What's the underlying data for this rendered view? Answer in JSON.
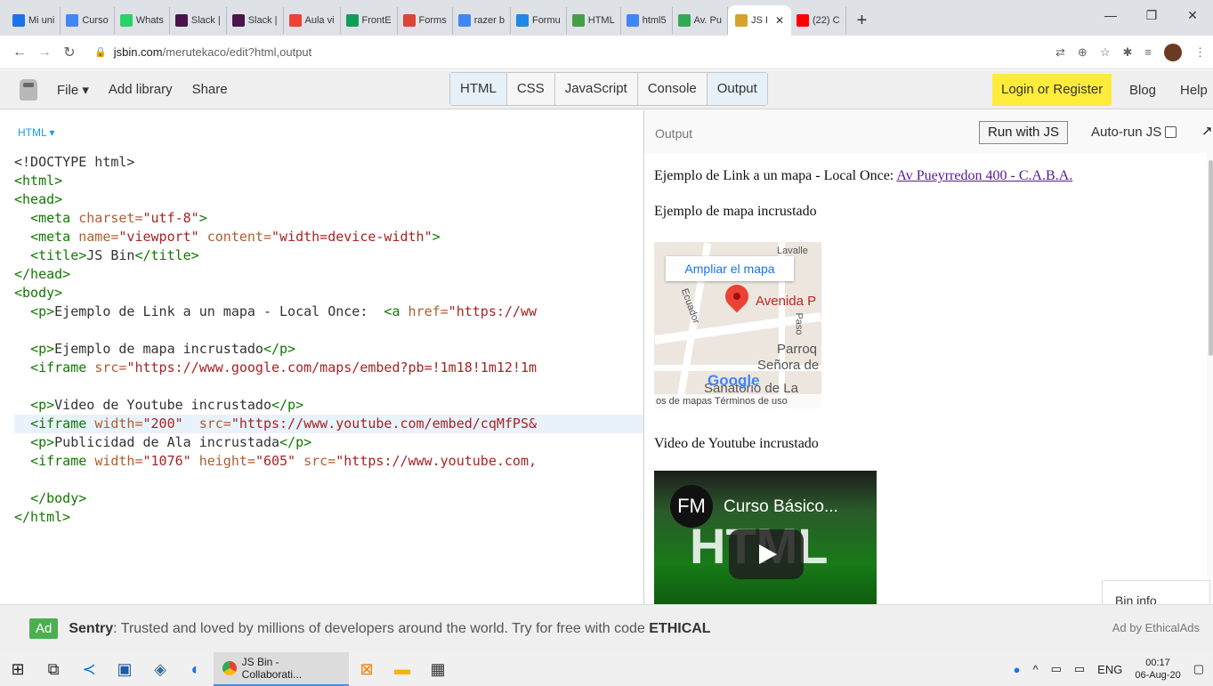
{
  "browser": {
    "tabs": [
      {
        "label": "Mi uni",
        "color": "#1a73e8"
      },
      {
        "label": "Curso",
        "color": "#4285f4"
      },
      {
        "label": "Whats",
        "color": "#25d366"
      },
      {
        "label": "Slack |",
        "color": "#4a154b"
      },
      {
        "label": "Slack |",
        "color": "#4a154b"
      },
      {
        "label": "Aula vi",
        "color": "#ea4335"
      },
      {
        "label": "FrontE",
        "color": "#0f9d58"
      },
      {
        "label": "Forms",
        "color": "#db4437"
      },
      {
        "label": "razer b",
        "color": "#4285f4"
      },
      {
        "label": "Formu",
        "color": "#1e88e5"
      },
      {
        "label": "HTML",
        "color": "#43a047"
      },
      {
        "label": "html5",
        "color": "#4285f4"
      },
      {
        "label": "Av. Pu",
        "color": "#34a853"
      },
      {
        "label": "JS I",
        "color": "#d6a32a"
      },
      {
        "label": "(22) C",
        "color": "#ff0000"
      }
    ],
    "new_tab": "+",
    "window_controls": [
      "—",
      "❐",
      "✕"
    ],
    "url_host": "jsbin.com",
    "url_path": "/merutekaco/edit?html,output"
  },
  "jsbin": {
    "menu": {
      "file": "File ▾",
      "add_library": "Add library",
      "share": "Share"
    },
    "panels": [
      "HTML",
      "CSS",
      "JavaScript",
      "Console",
      "Output"
    ],
    "login": "Login or Register",
    "blog": "Blog",
    "help": "Help"
  },
  "editor": {
    "label": "HTML ▾",
    "lines": [
      [
        [
          "tx",
          "<!DOCTYPE html>"
        ]
      ],
      [
        [
          "tg",
          "<html>"
        ]
      ],
      [
        [
          "tg",
          "<head>"
        ]
      ],
      [
        [
          "tx",
          "  "
        ],
        [
          "tg",
          "<meta "
        ],
        [
          "at",
          "charset="
        ],
        [
          "st",
          "\"utf-8\""
        ],
        [
          "tg",
          ">"
        ]
      ],
      [
        [
          "tx",
          "  "
        ],
        [
          "tg",
          "<meta "
        ],
        [
          "at",
          "name="
        ],
        [
          "st",
          "\"viewport\" "
        ],
        [
          "at",
          "content="
        ],
        [
          "st",
          "\"width=device-width\""
        ],
        [
          "tg",
          ">"
        ]
      ],
      [
        [
          "tx",
          "  "
        ],
        [
          "tg",
          "<title>"
        ],
        [
          "tx",
          "JS Bin"
        ],
        [
          "tg",
          "</title>"
        ]
      ],
      [
        [
          "tg",
          "</head>"
        ]
      ],
      [
        [
          "tg",
          "<body>"
        ]
      ],
      [
        [
          "tx",
          "  "
        ],
        [
          "tg",
          "<p>"
        ],
        [
          "tx",
          "Ejemplo de Link a un mapa - Local Once:  "
        ],
        [
          "tg",
          "<a "
        ],
        [
          "at",
          "href="
        ],
        [
          "st",
          "\"https://ww"
        ]
      ],
      [
        [
          "tx",
          ""
        ]
      ],
      [
        [
          "tx",
          "  "
        ],
        [
          "tg",
          "<p>"
        ],
        [
          "tx",
          "Ejemplo de mapa incrustado"
        ],
        [
          "tg",
          "</p>"
        ]
      ],
      [
        [
          "tx",
          "  "
        ],
        [
          "tg",
          "<iframe "
        ],
        [
          "at",
          "src="
        ],
        [
          "st",
          "\"https://www.google.com/maps/embed?pb=!1m18!1m12!1m"
        ]
      ],
      [
        [
          "tx",
          ""
        ]
      ],
      [
        [
          "tx",
          "  "
        ],
        [
          "tg",
          "<p>"
        ],
        [
          "tx",
          "Video de Youtube incrustado"
        ],
        [
          "tg",
          "</p>"
        ]
      ],
      [
        [
          "tx",
          "  "
        ],
        [
          "tg",
          "<iframe "
        ],
        [
          "at",
          "width="
        ],
        [
          "st",
          "\"200\"  "
        ],
        [
          "at",
          "src="
        ],
        [
          "st",
          "\"https://www.youtube.com/embed/cqMfPS&"
        ]
      ],
      [
        [
          "tx",
          "  "
        ],
        [
          "tg",
          "<p>"
        ],
        [
          "tx",
          "Publicidad de Ala incrustada"
        ],
        [
          "tg",
          "</p>"
        ]
      ],
      [
        [
          "tx",
          "  "
        ],
        [
          "tg",
          "<iframe "
        ],
        [
          "at",
          "width="
        ],
        [
          "st",
          "\"1076\" "
        ],
        [
          "at",
          "height="
        ],
        [
          "st",
          "\"605\" "
        ],
        [
          "at",
          "src="
        ],
        [
          "st",
          "\"https://www.youtube.com,"
        ]
      ],
      [
        [
          "tx",
          ""
        ]
      ],
      [
        [
          "tx",
          "  "
        ],
        [
          "tg",
          "</body>"
        ]
      ],
      [
        [
          "tg",
          "</html>"
        ]
      ]
    ],
    "highlighted_line": 14
  },
  "output": {
    "label": "Output",
    "run_button": "Run with JS",
    "autorun_label": "Auto-run JS",
    "expand_icon": "↗",
    "p1_text": "Ejemplo de Link a un mapa - Local Once: ",
    "p1_link": "Av Pueyrredon 400 - C.A.B.A.",
    "p2_text": "Ejemplo de mapa incrustado",
    "map": {
      "ampliar": "Ampliar el mapa",
      "street1": "Avenida P",
      "street2": "Ecuador",
      "street3": "Paso",
      "place1": "Parroq",
      "place2": "Señora de",
      "place3": "Sanatorio de La",
      "place4": "Lavalle",
      "google": "Google",
      "footer": "os de mapas   Términos de uso"
    },
    "p3_text": "Video de Youtube incrustado",
    "video": {
      "channel": "FM",
      "title": "Curso Básico...",
      "overlay": "HTML"
    },
    "bin_info": "Bin info"
  },
  "ad": {
    "tag": "Ad",
    "brand": "Sentry",
    "text": ": Trusted and loved by millions of developers around the world. Try for free with code ",
    "code": "ETHICAL",
    "by": "Ad by EthicalAds"
  },
  "taskbar": {
    "app_label": "JS Bin - Collaborati...",
    "lang": "ENG",
    "time": "00:17",
    "date": "06-Aug-20"
  }
}
